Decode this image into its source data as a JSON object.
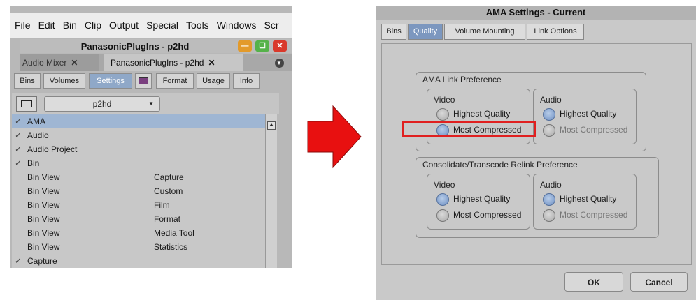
{
  "menu": [
    "File",
    "Edit",
    "Bin",
    "Clip",
    "Output",
    "Special",
    "Tools",
    "Windows",
    "Scr"
  ],
  "project_window": {
    "title": "PanasonicPlugIns - p2hd",
    "tabs": [
      {
        "label": "Audio Mixer"
      },
      {
        "label": "PanasonicPlugIns - p2hd"
      }
    ],
    "subtabs": [
      "Bins",
      "Volumes",
      "Settings",
      "Format",
      "Usage",
      "Info"
    ],
    "active_subtab": "Settings",
    "settings_dropdown": "p2hd",
    "rows": [
      {
        "check": "✓",
        "name": "AMA",
        "value": "",
        "selected": true
      },
      {
        "check": "✓",
        "name": "Audio",
        "value": ""
      },
      {
        "check": "✓",
        "name": "Audio Project",
        "value": ""
      },
      {
        "check": "✓",
        "name": "Bin",
        "value": ""
      },
      {
        "check": "",
        "name": "Bin View",
        "value": "Capture"
      },
      {
        "check": "",
        "name": "Bin View",
        "value": "Custom"
      },
      {
        "check": "",
        "name": "Bin View",
        "value": "Film"
      },
      {
        "check": "",
        "name": "Bin View",
        "value": "Format"
      },
      {
        "check": "",
        "name": "Bin View",
        "value": "Media Tool"
      },
      {
        "check": "",
        "name": "Bin View",
        "value": "Statistics"
      },
      {
        "check": "✓",
        "name": "Capture",
        "value": ""
      }
    ]
  },
  "dialog": {
    "title": "AMA Settings - Current",
    "tabs": [
      "Bins",
      "Quality",
      "Volume Mounting",
      "Link Options"
    ],
    "active_tab": "Quality",
    "ama_group": {
      "title": "AMA Link Preference",
      "video": {
        "label": "Video",
        "opt1": "Highest Quality",
        "opt2": "Most Compressed"
      },
      "audio": {
        "label": "Audio",
        "opt1": "Highest Quality",
        "opt2": "Most Compressed"
      }
    },
    "consolidate_group": {
      "title": "Consolidate/Transcode Relink Preference",
      "video": {
        "label": "Video",
        "opt1": "Highest Quality",
        "opt2": "Most Compressed"
      },
      "audio": {
        "label": "Audio",
        "opt1": "Highest Quality",
        "opt2": "Most Compressed"
      }
    },
    "ok": "OK",
    "cancel": "Cancel"
  },
  "colors": {
    "highlight": "#e02020",
    "arrow": "#e81010",
    "accent": "#7c97bf"
  }
}
